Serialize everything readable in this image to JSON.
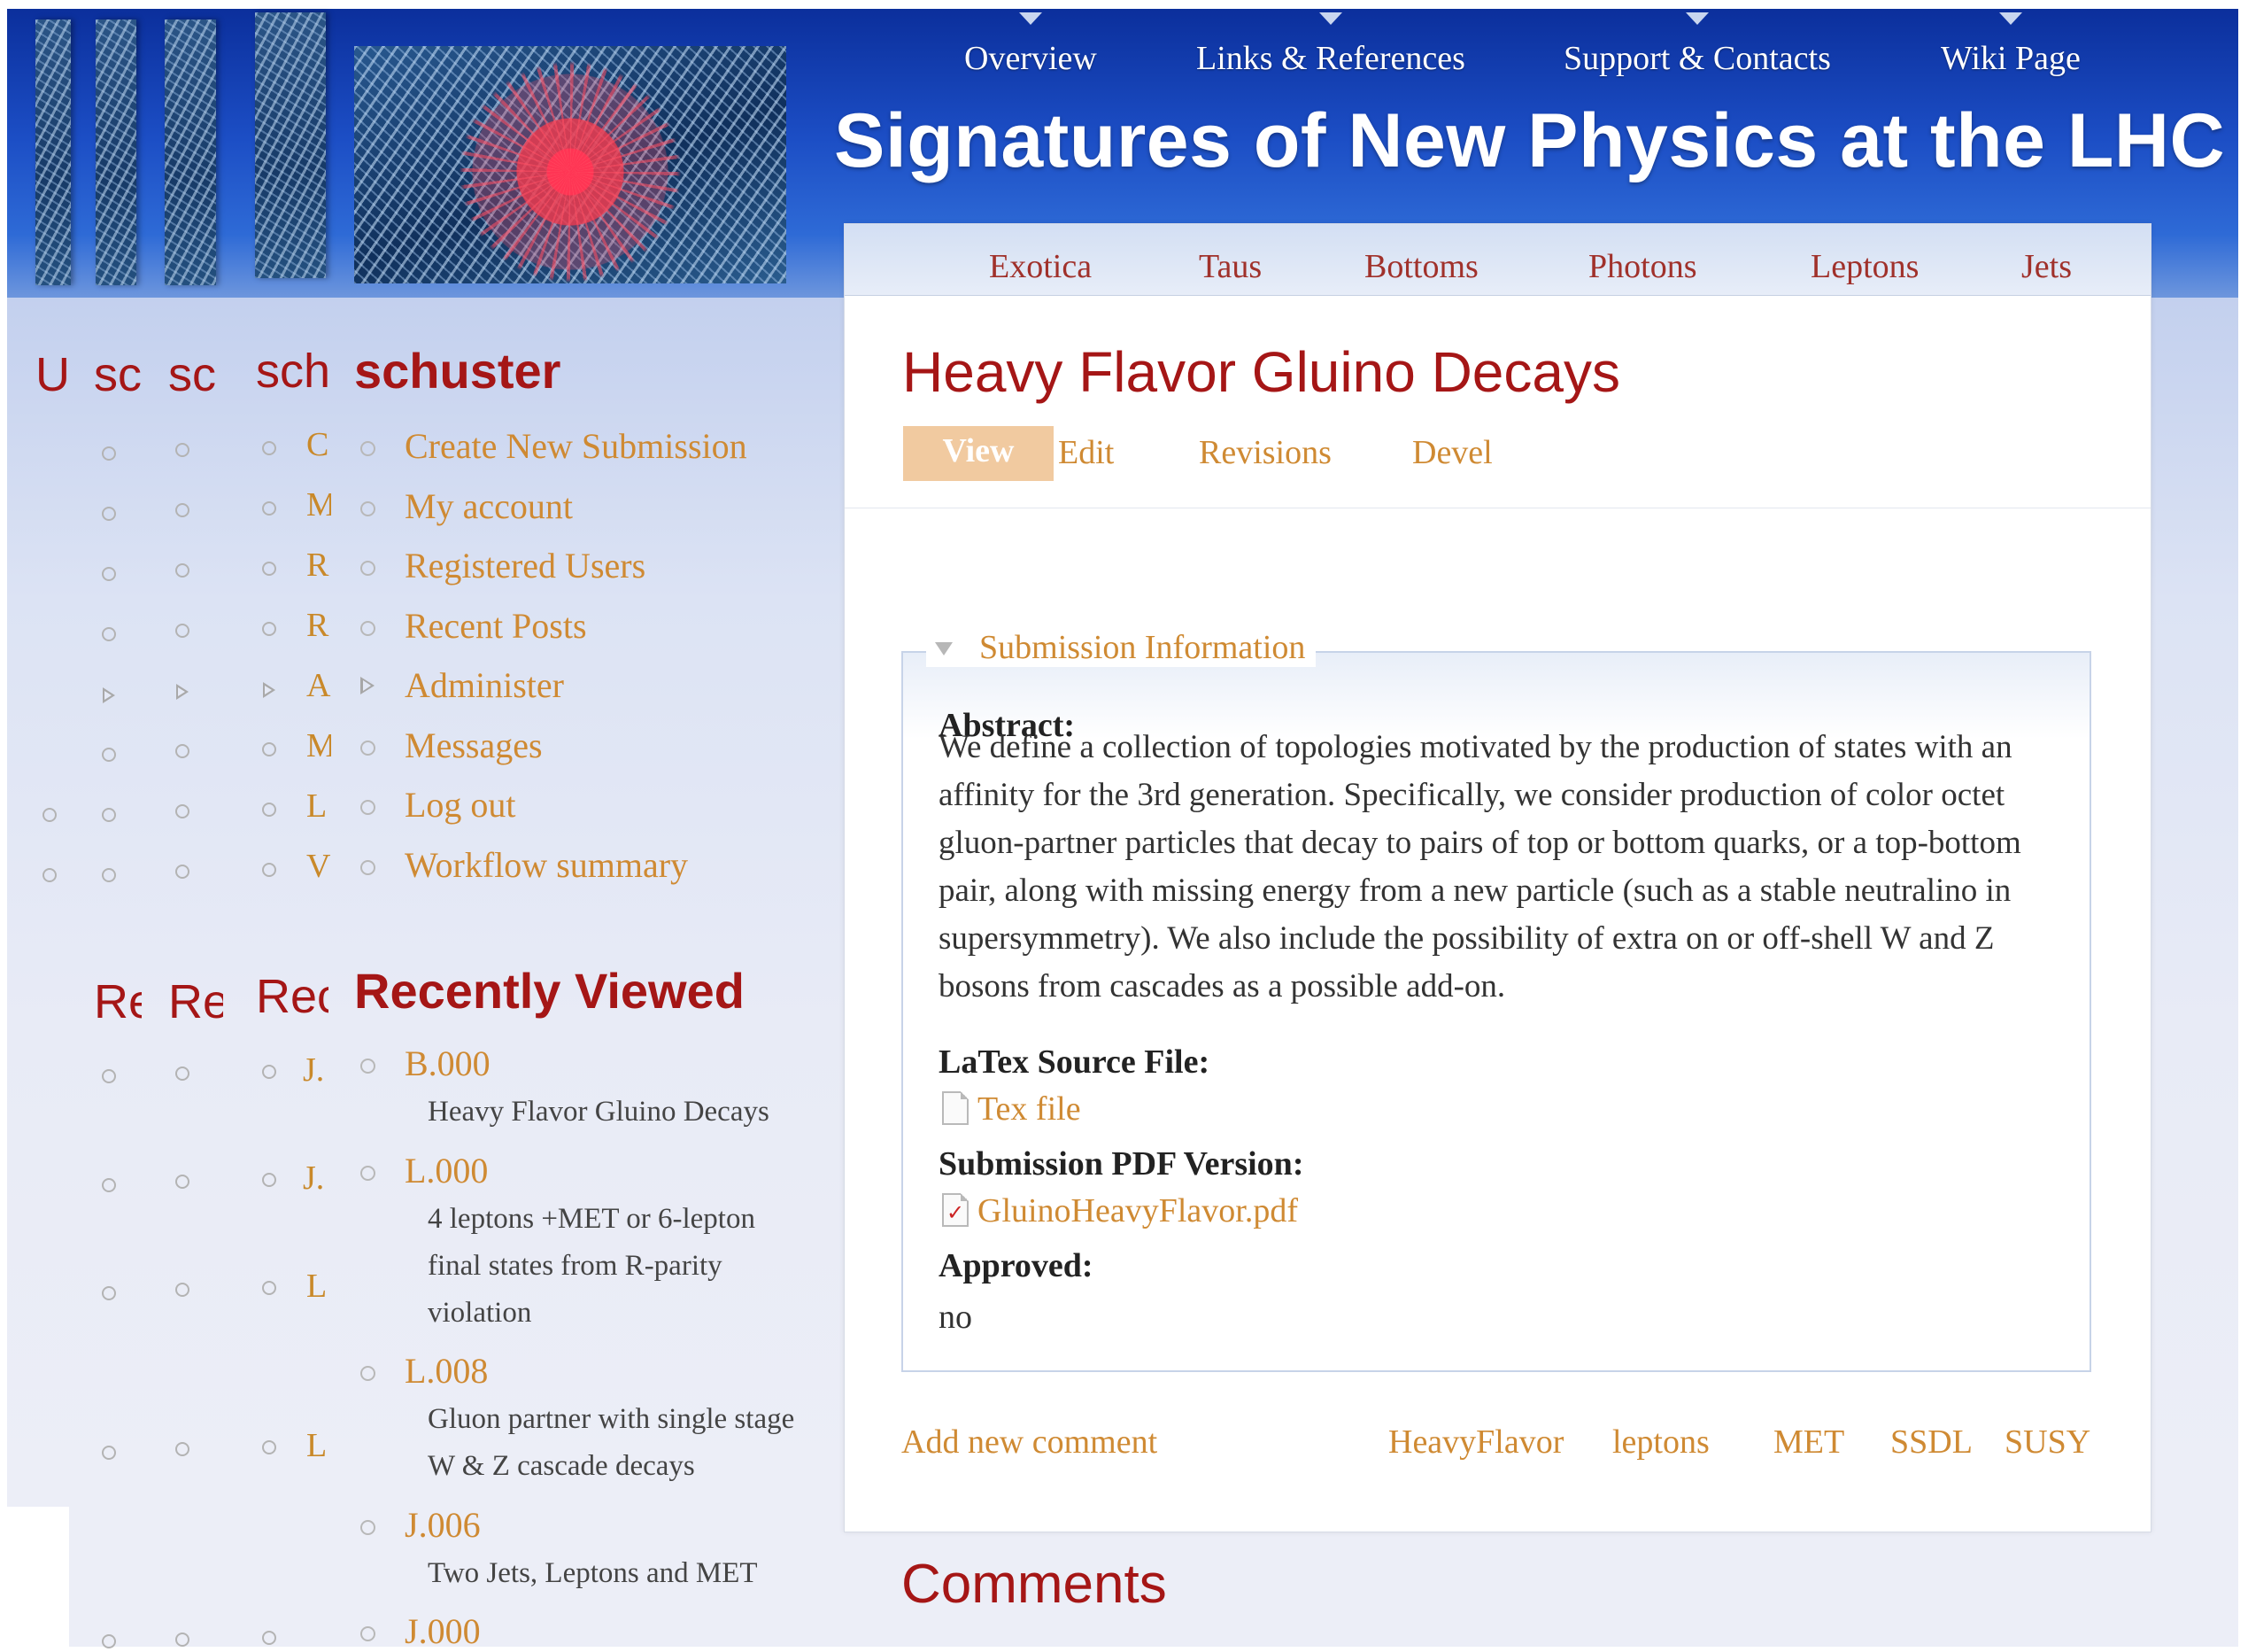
{
  "top_nav": [
    {
      "label": "Overview"
    },
    {
      "label": "Links & References"
    },
    {
      "label": "Support & Contacts"
    },
    {
      "label": "Wiki Page"
    }
  ],
  "site_title": "Signatures of New Physics at the LHC",
  "primary_tabs": [
    {
      "label": "Exotica"
    },
    {
      "label": "Taus"
    },
    {
      "label": "Bottoms"
    },
    {
      "label": "Photons"
    },
    {
      "label": "Leptons"
    },
    {
      "label": "Jets"
    }
  ],
  "ghost_sidebars": {
    "user_headings": [
      "U",
      "sc",
      "sc",
      "sch"
    ],
    "recent_headings": [
      "Re",
      "Re",
      "Rec"
    ],
    "menu_initials": [
      "C",
      "M",
      "R",
      "R",
      "A",
      "M",
      "L",
      "V"
    ],
    "recent_initials": [
      "J.",
      "J.",
      "L",
      "L"
    ]
  },
  "sidebar": {
    "user_heading": "schuster",
    "menu": [
      {
        "label": "Create New Submission",
        "expandable": false
      },
      {
        "label": "My account",
        "expandable": false
      },
      {
        "label": "Registered Users",
        "expandable": false
      },
      {
        "label": "Recent Posts",
        "expandable": false
      },
      {
        "label": "Administer",
        "expandable": true
      },
      {
        "label": "Messages",
        "expandable": false
      },
      {
        "label": "Log out",
        "expandable": false
      },
      {
        "label": "Workflow summary",
        "expandable": false
      }
    ],
    "recently_viewed_heading": "Recently Viewed",
    "recently_viewed": [
      {
        "id": "B.000",
        "desc": "Heavy Flavor Gluino Decays"
      },
      {
        "id": "L.000",
        "desc": "4 leptons +MET or 6-lepton final states from R-parity violation"
      },
      {
        "id": "L.008",
        "desc": "Gluon partner with single stage W & Z cascade decays"
      },
      {
        "id": "J.006",
        "desc": "Two Jets, Leptons and MET"
      },
      {
        "id": "J.000",
        "desc": ""
      }
    ]
  },
  "node": {
    "title": "Heavy Flavor Gluino Decays",
    "tabs": [
      {
        "label": "View",
        "active": true
      },
      {
        "label": "Edit",
        "active": false
      },
      {
        "label": "Revisions",
        "active": false
      },
      {
        "label": "Devel",
        "active": false
      }
    ],
    "fieldset_legend": "Submission Information",
    "abstract_label": "Abstract:",
    "abstract": "We define a collection of topologies motivated by the production of states with an affinity for the 3rd generation. Specifically, we consider production of color octet gluon-partner particles that decay to pairs of top or bottom quarks, or a top-bottom pair, along with missing energy from a new particle (such as a stable neutralino in supersymmetry). We also include the possibility of extra on or off-shell W and Z bosons from cascades as a possible add-on.",
    "latex_label": "LaTex Source File:",
    "latex_file": "Tex file",
    "pdf_label": "Submission PDF Version:",
    "pdf_file": "GluinoHeavyFlavor.pdf",
    "approved_label": "Approved:",
    "approved_value": "no",
    "add_comment": "Add new comment",
    "tags": [
      "HeavyFlavor",
      "leptons",
      "MET",
      "SSDL",
      "SUSY"
    ],
    "comments_heading": "Comments"
  },
  "colors": {
    "accent_link": "#cf8a33",
    "heading_red": "#a51616",
    "banner_blue": "#1c4ec5"
  }
}
